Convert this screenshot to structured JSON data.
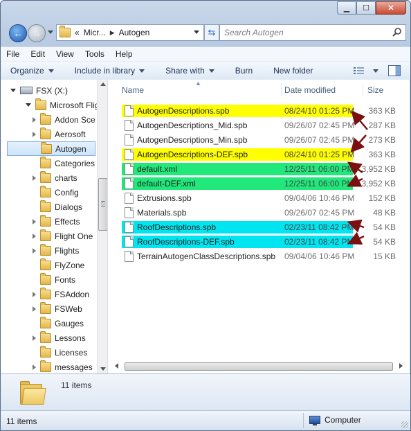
{
  "window": {
    "controls": {
      "minimize": "▁",
      "maximize": "☐",
      "close": "✕"
    }
  },
  "address": {
    "chevron": "«",
    "crumb1": "Micr...",
    "crumb2": "Autogen",
    "search_placeholder": "Search Autogen"
  },
  "menu": [
    "File",
    "Edit",
    "View",
    "Tools",
    "Help"
  ],
  "commands": {
    "organize": "Organize",
    "include": "Include in library",
    "share": "Share with",
    "burn": "Burn",
    "newfolder": "New folder"
  },
  "nav": {
    "drive": "FSX (X:)",
    "root": "Microsoft Flig",
    "items": [
      "Addon Sce",
      "Aerosoft",
      "Autogen",
      "Categories",
      "charts",
      "Config",
      "Dialogs",
      "Effects",
      "Flight One",
      "Flights",
      "FlyZone",
      "Fonts",
      "FSAddon",
      "FSWeb",
      "Gauges",
      "Lessons",
      "Licenses",
      "messages"
    ]
  },
  "columns": {
    "name": "Name",
    "date": "Date modified",
    "size": "Size"
  },
  "files": [
    {
      "name": "AutogenDescriptions.spb",
      "date": "08/24/10 01:25 PM",
      "size": "363 KB",
      "highlight": "#ffff00"
    },
    {
      "name": "AutogenDescriptions_Mid.spb",
      "date": "09/26/07 02:45 PM",
      "size": "287 KB",
      "highlight": ""
    },
    {
      "name": "AutogenDescriptions_Min.spb",
      "date": "09/26/07 02:45 PM",
      "size": "273 KB",
      "highlight": ""
    },
    {
      "name": "AutogenDescriptions-DEF.spb",
      "date": "08/24/10 01:25 PM",
      "size": "363 KB",
      "highlight": "#ffff00"
    },
    {
      "name": "default.xml",
      "date": "12/25/11 06:00 PM",
      "size": "3,952 KB",
      "highlight": "#20e87a"
    },
    {
      "name": "default-DEF.xml",
      "date": "12/25/11 06:00 PM",
      "size": "3,952 KB",
      "highlight": "#20e87a"
    },
    {
      "name": "Extrusions.spb",
      "date": "09/04/06 10:46 PM",
      "size": "152 KB",
      "highlight": ""
    },
    {
      "name": "Materials.spb",
      "date": "09/26/07 02:45 PM",
      "size": "48 KB",
      "highlight": ""
    },
    {
      "name": "RoofDescriptions.spb",
      "date": "02/23/11 08:42 PM",
      "size": "54 KB",
      "highlight": "#00e5ef"
    },
    {
      "name": "RoofDescriptions-DEF.spb",
      "date": "02/23/11 08:42 PM",
      "size": "54 KB",
      "highlight": "#00e5ef"
    },
    {
      "name": "TerrainAutogenClassDescriptions.spb",
      "date": "09/04/06 10:46 PM",
      "size": "15 KB",
      "highlight": ""
    }
  ],
  "details": {
    "count": "11 items"
  },
  "status": {
    "left": "11 items",
    "computer": "Computer"
  },
  "colors": {
    "arrow": "#7a1010"
  }
}
